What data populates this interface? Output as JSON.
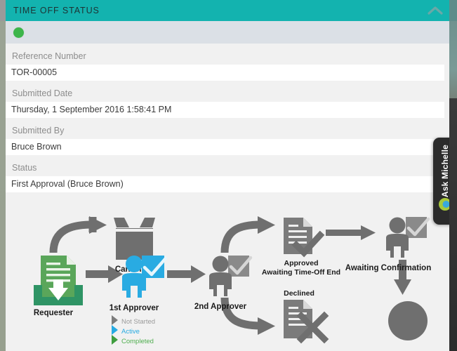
{
  "panel": {
    "title": "TIME OFF STATUS",
    "collapse_icon": "chevron-up-icon",
    "header_color": "#13b3af",
    "status_dot_color": "#3cb54a",
    "status_dot_icon": "status-dot-green"
  },
  "form": {
    "fields": [
      {
        "label": "Reference Number",
        "value": "TOR-00005"
      },
      {
        "label": "Submitted Date",
        "value": "Thursday, 1 September 2016 1:58:41 PM"
      },
      {
        "label": "Submitted By",
        "value": "Bruce Brown"
      },
      {
        "label": "Status",
        "value": "First Approval (Bruce Brown)"
      }
    ]
  },
  "diagram": {
    "nodes": {
      "requester": "Requester",
      "cancelled": "Cancelled",
      "approver1": "1st Approver",
      "approver2": "2nd Approver",
      "approved": "Approved",
      "approved_sub": "Awaiting Time-Off End",
      "declined": "Declined",
      "awaiting_confirmation": "Awaiting Confirmation"
    },
    "icons": {
      "requester": "document-inbox-icon",
      "cancelled": "open-box-icon",
      "approver1": "person-checkbox-icon",
      "approver2": "person-checkbox-icon",
      "approved": "document-check-icon",
      "declined": "document-x-icon",
      "awaiting_confirmation": "person-checkbox-icon",
      "end": "circle-end-icon"
    },
    "legend": [
      {
        "label": "Not Started",
        "color": "#7c7c7c"
      },
      {
        "label": "Active",
        "color": "#27aae1"
      },
      {
        "label": "Completed",
        "color": "#4fae4f"
      }
    ],
    "colors": {
      "not_started": "#6f6f6f",
      "active": "#27aae1",
      "completed": "#4a9d4a",
      "completed_dark": "#2e8b57",
      "background": "#f1f1f1"
    }
  },
  "ask_tab": {
    "label": "Ask Michelle",
    "logo_icon": "michelle-logo-icon"
  }
}
